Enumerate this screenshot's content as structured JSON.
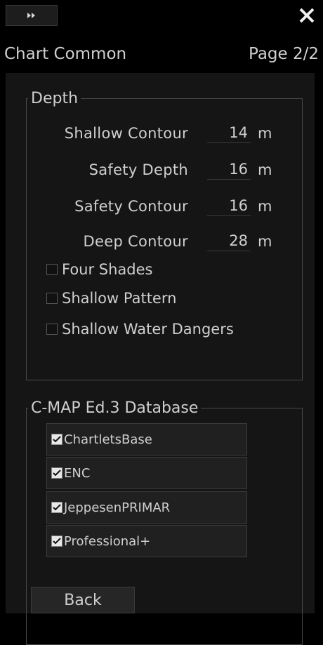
{
  "titlebar": {
    "collapse_icon": "double-chevron-right-icon",
    "close_icon": "close-icon"
  },
  "header": {
    "title": "Chart Common",
    "page": "Page 2/2"
  },
  "depth": {
    "legend": "Depth",
    "fields": [
      {
        "label": "Shallow Contour",
        "value": "14",
        "unit": "m"
      },
      {
        "label": "Safety Depth",
        "value": "16",
        "unit": "m"
      },
      {
        "label": "Safety Contour",
        "value": "16",
        "unit": "m"
      },
      {
        "label": "Deep Contour",
        "value": "28",
        "unit": "m"
      }
    ],
    "options": [
      {
        "label": "Four Shades",
        "checked": false
      },
      {
        "label": "Shallow Pattern",
        "checked": false
      },
      {
        "label": "Shallow Water Dangers",
        "checked": false
      }
    ]
  },
  "cmap": {
    "legend": "C-MAP Ed.3 Database",
    "items": [
      {
        "label": "ChartletsBase",
        "checked": true
      },
      {
        "label": "ENC",
        "checked": true
      },
      {
        "label": "JeppesenPRIMAR",
        "checked": true
      },
      {
        "label": "Professional+",
        "checked": true
      }
    ]
  },
  "footer": {
    "back_label": "Back"
  },
  "colors": {
    "background": "#000000",
    "panel": "#151515",
    "text": "#cfcfcf",
    "border": "#4a4a4a"
  }
}
